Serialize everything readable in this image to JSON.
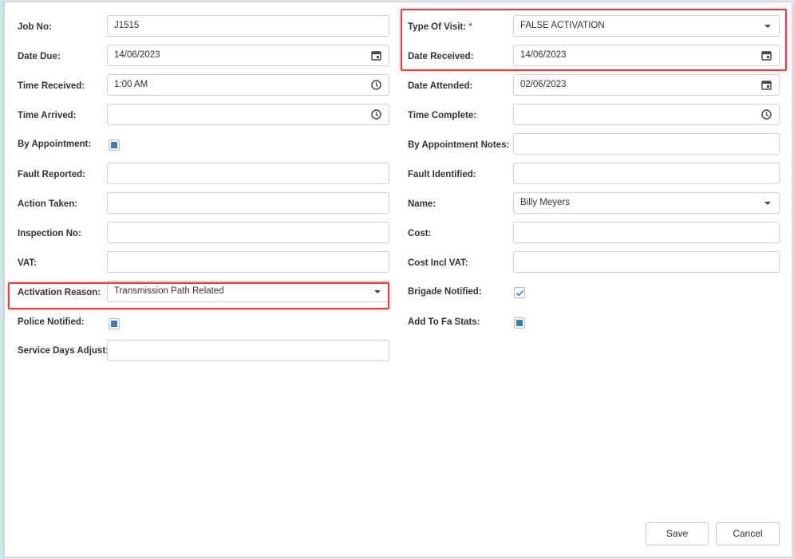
{
  "form": {
    "left": [
      {
        "label": "Job No:",
        "value": "J1515",
        "type": "text"
      },
      {
        "label": "Date Due:",
        "value": "14/06/2023",
        "type": "date"
      },
      {
        "label": "Time Received:",
        "value": "1:00 AM",
        "type": "time"
      },
      {
        "label": "Time Arrived:",
        "value": "",
        "type": "time"
      },
      {
        "label": "By Appointment:",
        "type": "checkbox",
        "checked": "filled"
      },
      {
        "label": "Fault Reported:",
        "value": "",
        "type": "text"
      },
      {
        "label": "Action Taken:",
        "value": "",
        "type": "text"
      },
      {
        "label": "Inspection No:",
        "value": "",
        "type": "text"
      },
      {
        "label": "VAT:",
        "value": "",
        "type": "text"
      },
      {
        "label": "Activation Reason:",
        "value": "Transmission Path Related",
        "type": "select"
      },
      {
        "label": "Police Notified:",
        "type": "checkbox",
        "checked": "filled"
      },
      {
        "label": "Service Days Adjust:",
        "value": "",
        "type": "text"
      }
    ],
    "right": [
      {
        "label": "Type Of Visit:",
        "required_mark": "*",
        "value": "FALSE ACTIVATION",
        "type": "select"
      },
      {
        "label": "Date Received:",
        "value": "14/06/2023",
        "type": "date"
      },
      {
        "label": "Date Attended:",
        "value": "02/06/2023",
        "type": "date"
      },
      {
        "label": "Time Complete:",
        "value": "",
        "type": "time"
      },
      {
        "label": "By Appointment Notes:",
        "value": "",
        "type": "text"
      },
      {
        "label": "Fault Identified:",
        "value": "",
        "type": "text"
      },
      {
        "label": "Name:",
        "value": "Billy Meyers",
        "type": "select"
      },
      {
        "label": "Cost:",
        "value": "",
        "type": "text"
      },
      {
        "label": "Cost Incl VAT:",
        "value": "",
        "type": "text"
      },
      {
        "label": "Brigade Notified:",
        "type": "checkbox",
        "checked": "tick"
      },
      {
        "label": "Add To Fa Stats:",
        "type": "checkbox",
        "checked": "filled"
      }
    ]
  },
  "buttons": {
    "save": "Save",
    "cancel": "Cancel"
  },
  "colors": {
    "highlight": "#e04040",
    "checkbox_fill": "#3a7bc0",
    "required": "#d9534f"
  },
  "icons": {
    "date": "calendar-icon",
    "time": "clock-icon",
    "select": "caret-down-icon"
  }
}
